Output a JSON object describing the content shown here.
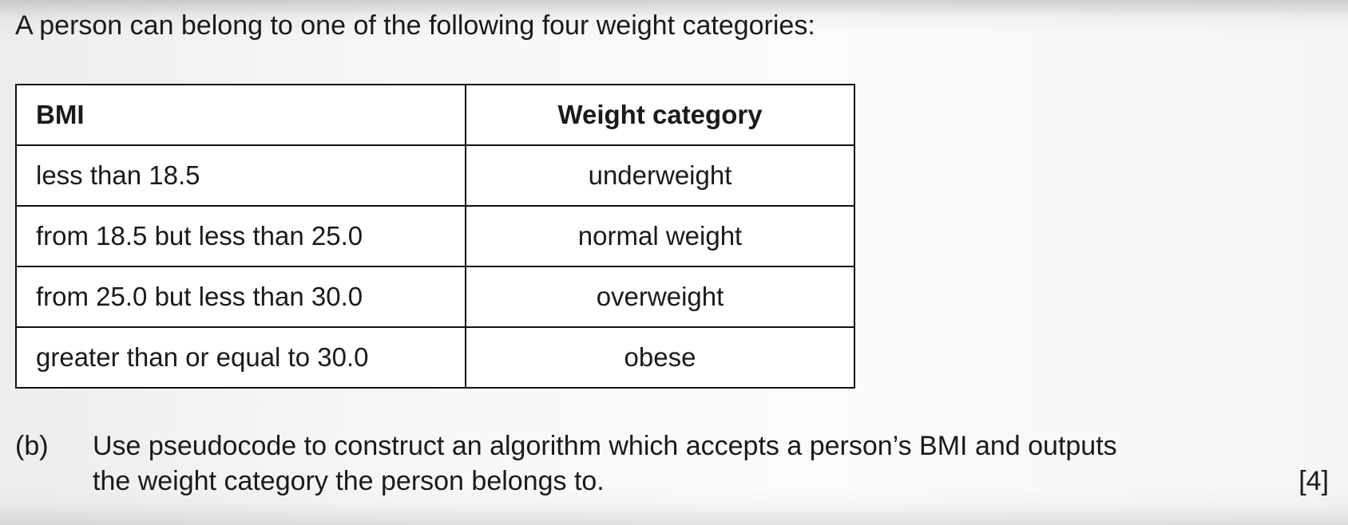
{
  "intro": "A person can belong to one of the following four weight categories:",
  "table": {
    "headers": {
      "bmi": "BMI",
      "category": "Weight category"
    },
    "rows": [
      {
        "bmi": "less than 18.5",
        "category": "underweight"
      },
      {
        "bmi": "from 18.5 but less than 25.0",
        "category": "normal weight"
      },
      {
        "bmi": "from 25.0 but less than 30.0",
        "category": "overweight"
      },
      {
        "bmi": "greater than or equal to 30.0",
        "category": "obese"
      }
    ]
  },
  "question": {
    "part": "(b)",
    "line1": "Use pseudocode to construct an algorithm which accepts a person’s BMI and outputs",
    "line2": "the weight category the person belongs to.",
    "marks": "[4]"
  }
}
